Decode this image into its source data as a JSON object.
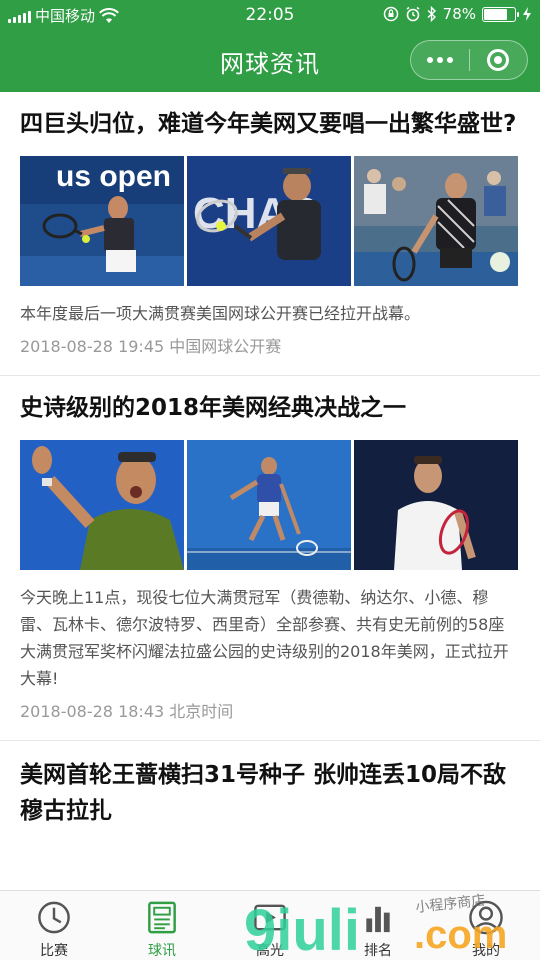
{
  "status_bar": {
    "carrier": "中国移动",
    "time": "22:05",
    "battery": "78%",
    "battery_level": 0.78
  },
  "header": {
    "title": "网球资讯"
  },
  "articles": [
    {
      "title": "四巨头归位，难道今年美网又要唱一出繁华盛世?",
      "summary": "本年度最后一项大满贯赛美国网球公开赛已经拉开战幕。",
      "date": "2018-08-28 19:45",
      "source": "中国网球公开赛"
    },
    {
      "title": "史诗级别的2018年美网经典决战之一",
      "summary": "今天晚上11点，现役七位大满贯冠军（费德勒、纳达尔、小德、穆雷、瓦林卡、德尔波特罗、西里奇）全部参赛、共有史无前例的58座大满贯冠军奖杯闪耀法拉盛公园的史诗级别的2018年美网，正式拉开大幕!",
      "date": "2018-08-28 18:43",
      "source": "北京时间"
    },
    {
      "title": "美网首轮王蔷横扫31号种子 张帅连丢10局不敌穆古拉扎"
    }
  ],
  "photo_text": {
    "usopen": "us open",
    "chase": "CHAS"
  },
  "tabbar": {
    "tabs": [
      {
        "label": "比赛",
        "icon": "clock-icon"
      },
      {
        "label": "球讯",
        "icon": "news-icon"
      },
      {
        "label": "高光",
        "icon": "video-icon"
      },
      {
        "label": "排名",
        "icon": "bar-chart-icon"
      },
      {
        "label": "我的",
        "icon": "user-icon"
      }
    ],
    "active_index": 1
  },
  "watermark": {
    "script_text": "小程序商店",
    "brand": "9iuli",
    "domain": ".com"
  },
  "colors": {
    "brand_green": "#2f9e44",
    "title_text": "#111111",
    "summary_text": "#555555",
    "meta_text": "#999999"
  }
}
